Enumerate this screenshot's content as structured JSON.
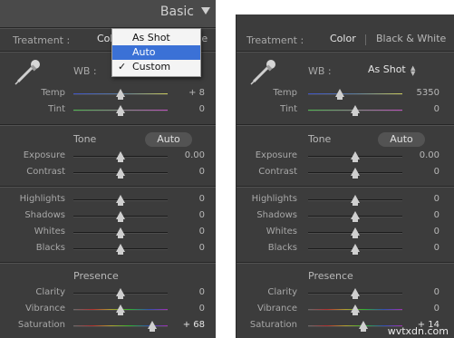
{
  "left": {
    "header_title": "Basic",
    "treatment_label": "Treatment :",
    "treatment_color_partial": "Colo",
    "treatment_bw_partial": "te",
    "wb_label": "WB :",
    "wb_menu": {
      "options": [
        "As Shot",
        "Auto",
        "Custom"
      ],
      "highlighted": "Auto",
      "checked": "Custom"
    },
    "sliders": {
      "temp": {
        "label": "Temp",
        "value": "+ 8",
        "position": 0.5
      },
      "tint": {
        "label": "Tint",
        "value": "0",
        "position": 0.5
      },
      "exposure": {
        "label": "Exposure",
        "value": "0.00",
        "position": 0.5
      },
      "contrast": {
        "label": "Contrast",
        "value": "0",
        "position": 0.5
      },
      "highlights": {
        "label": "Highlights",
        "value": "0",
        "position": 0.5
      },
      "shadows": {
        "label": "Shadows",
        "value": "0",
        "position": 0.5
      },
      "whites": {
        "label": "Whites",
        "value": "0",
        "position": 0.5
      },
      "blacks": {
        "label": "Blacks",
        "value": "0",
        "position": 0.5
      },
      "clarity": {
        "label": "Clarity",
        "value": "0",
        "position": 0.5
      },
      "vibrance": {
        "label": "Vibrance",
        "value": "0",
        "position": 0.5
      },
      "saturation": {
        "label": "Saturation",
        "value": "+ 68",
        "position": 0.84
      }
    },
    "tone_label": "Tone",
    "auto_label": "Auto",
    "presence_label": "Presence"
  },
  "right": {
    "treatment_label": "Treatment :",
    "treatment_color": "Color",
    "treatment_bw": "Black & White",
    "wb_label": "WB :",
    "wb_value": "As Shot",
    "sliders": {
      "temp": {
        "label": "Temp",
        "value": "5350",
        "position": 0.34
      },
      "tint": {
        "label": "Tint",
        "value": "0",
        "position": 0.5
      },
      "exposure": {
        "label": "Exposure",
        "value": "0.00",
        "position": 0.5
      },
      "contrast": {
        "label": "Contrast",
        "value": "0",
        "position": 0.5
      },
      "highlights": {
        "label": "Highlights",
        "value": "0",
        "position": 0.5
      },
      "shadows": {
        "label": "Shadows",
        "value": "0",
        "position": 0.5
      },
      "whites": {
        "label": "Whites",
        "value": "0",
        "position": 0.5
      },
      "blacks": {
        "label": "Blacks",
        "value": "0",
        "position": 0.5
      },
      "clarity": {
        "label": "Clarity",
        "value": "0",
        "position": 0.5
      },
      "vibrance": {
        "label": "Vibrance",
        "value": "0",
        "position": 0.5
      },
      "saturation": {
        "label": "Saturation",
        "value": "+ 14",
        "position": 0.59
      }
    },
    "tone_label": "Tone",
    "auto_label": "Auto",
    "presence_label": "Presence"
  },
  "watermark": "wvtxdn.com",
  "colors": {
    "panel_bg": "#3c3c3c",
    "menu_highlight": "#3b71d6",
    "temp_gradient": [
      "#3f55c8",
      "#c8c85a"
    ],
    "tint_gradient": [
      "#4fb84f",
      "#c04fc0"
    ]
  }
}
